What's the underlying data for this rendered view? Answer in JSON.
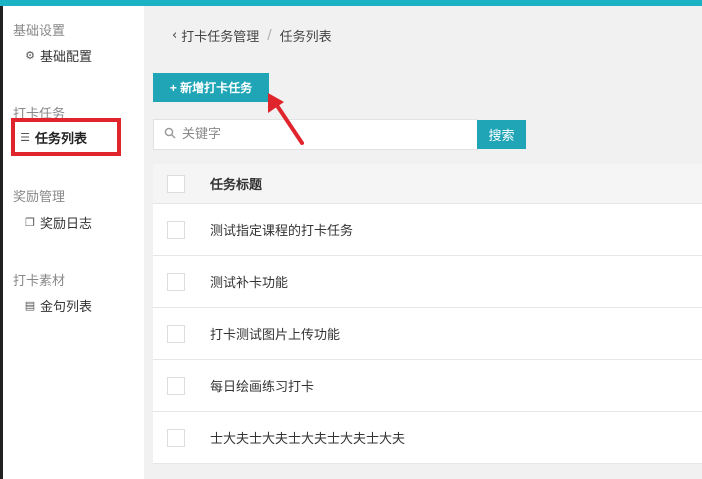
{
  "sidebar": {
    "groups": [
      {
        "label": "基础设置",
        "items": [
          {
            "label": "基础配置",
            "icon": "gears-icon"
          }
        ]
      },
      {
        "label": "打卡任务",
        "items": [
          {
            "label": "任务列表",
            "icon": "list-icon",
            "active": true
          }
        ]
      },
      {
        "label": "奖励管理",
        "items": [
          {
            "label": "奖励日志",
            "icon": "copy-icon"
          }
        ]
      },
      {
        "label": "打卡素材",
        "items": [
          {
            "label": "金句列表",
            "icon": "newspaper-icon"
          }
        ]
      }
    ]
  },
  "breadcrumb": {
    "parent": "打卡任务管理",
    "separator": "/",
    "current": "任务列表"
  },
  "toolbar": {
    "add_label": "+ 新增打卡任务"
  },
  "search": {
    "placeholder": "关键字",
    "value": "",
    "button_label": "搜索"
  },
  "table": {
    "columns": [
      "任务标题"
    ],
    "rows": [
      {
        "title": "测试指定课程的打卡任务"
      },
      {
        "title": "测试补卡功能"
      },
      {
        "title": "打卡测试图片上传功能"
      },
      {
        "title": "每日绘画练习打卡"
      },
      {
        "title": "士大夫士大夫士大夫士大夫士大夫"
      }
    ]
  },
  "colors": {
    "accent": "#1fa5b6",
    "topbar": "#1ab2c4",
    "highlight": "#e0242c"
  }
}
